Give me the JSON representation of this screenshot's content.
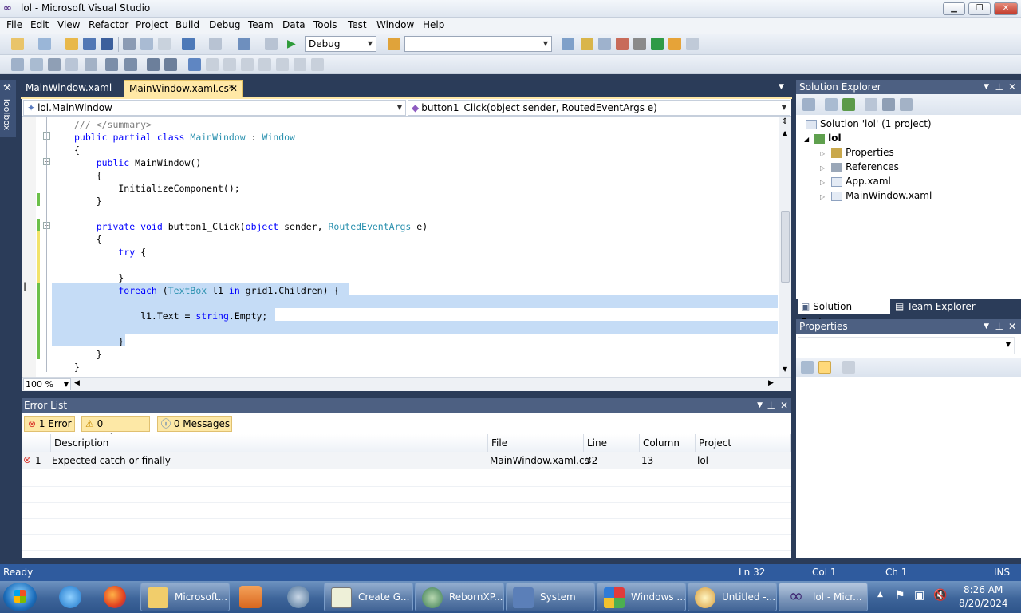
{
  "window": {
    "title": "lol - Microsoft Visual Studio",
    "minimize": "▁",
    "maximize": "❐",
    "close": "✕"
  },
  "menu": [
    "File",
    "Edit",
    "View",
    "Refactor",
    "Project",
    "Build",
    "Debug",
    "Team",
    "Data",
    "Tools",
    "Test",
    "Window",
    "Help"
  ],
  "toolbar": {
    "config": "Debug",
    "platform": ""
  },
  "toolbox_label": "Toolbox",
  "tabs": [
    {
      "label": "MainWindow.xaml",
      "active": false
    },
    {
      "label": "MainWindow.xaml.cs*",
      "active": true
    }
  ],
  "editor": {
    "class_combo": "lol.MainWindow",
    "member_combo": "button1_Click(object sender, RoutedEventArgs e)",
    "zoom": "100 %",
    "lines": [
      [
        {
          "t": "/// </summary>",
          "c": "cm"
        }
      ],
      [
        {
          "t": "public partial class ",
          "c": "kw"
        },
        {
          "t": "MainWindow",
          "c": "ty"
        },
        {
          "t": " : ",
          "c": ""
        },
        {
          "t": "Window",
          "c": "ty"
        }
      ],
      [
        {
          "t": "{",
          "c": ""
        }
      ],
      [
        {
          "t": "    public ",
          "c": "kw"
        },
        {
          "t": "MainWindow()",
          "c": ""
        }
      ],
      [
        {
          "t": "    {",
          "c": ""
        }
      ],
      [
        {
          "t": "        InitializeComponent();",
          "c": ""
        }
      ],
      [
        {
          "t": "    }",
          "c": ""
        }
      ],
      [
        {
          "t": "",
          "c": ""
        }
      ],
      [
        {
          "t": "    private void ",
          "c": "kw"
        },
        {
          "t": "button1_Click(",
          "c": ""
        },
        {
          "t": "object",
          "c": "kw"
        },
        {
          "t": " sender, ",
          "c": ""
        },
        {
          "t": "RoutedEventArgs",
          "c": "ty"
        },
        {
          "t": " e)",
          "c": ""
        }
      ],
      [
        {
          "t": "    {",
          "c": ""
        }
      ],
      [
        {
          "t": "        try",
          "c": "kw"
        },
        {
          "t": " {",
          "c": ""
        }
      ],
      [
        {
          "t": "",
          "c": ""
        }
      ],
      [
        {
          "t": "        }",
          "c": ""
        }
      ],
      [
        {
          "t": "        foreach",
          "c": "kw"
        },
        {
          "t": " (",
          "c": ""
        },
        {
          "t": "TextBox",
          "c": "ty"
        },
        {
          "t": " l1 ",
          "c": ""
        },
        {
          "t": "in",
          "c": "kw"
        },
        {
          "t": " grid1.Children) {",
          "c": ""
        }
      ],
      [
        {
          "t": "",
          "c": ""
        }
      ],
      [
        {
          "t": "            l1.Text = ",
          "c": ""
        },
        {
          "t": "string",
          "c": "kw"
        },
        {
          "t": ".Empty;",
          "c": ""
        }
      ],
      [
        {
          "t": "",
          "c": ""
        }
      ],
      [
        {
          "t": "        }",
          "c": ""
        }
      ],
      [
        {
          "t": "    }",
          "c": ""
        }
      ],
      [
        {
          "t": "}",
          "c": ""
        }
      ]
    ]
  },
  "error_list": {
    "title": "Error List",
    "filters": [
      "1 Error",
      "0 Warnings",
      "0 Messages"
    ],
    "columns": [
      "Description",
      "File",
      "Line",
      "Column",
      "Project"
    ],
    "rows": [
      {
        "num": "1",
        "description": "Expected catch or finally",
        "file": "MainWindow.xaml.cs",
        "line": "32",
        "column": "13",
        "project": "lol"
      }
    ]
  },
  "solution_explorer": {
    "title": "Solution Explorer",
    "solution": "Solution 'lol' (1 project)",
    "project": "lol",
    "items": [
      "Properties",
      "References",
      "App.xaml",
      "MainWindow.xaml"
    ],
    "tabs": [
      "Solution Explorer",
      "Team Explorer"
    ]
  },
  "properties_panel": {
    "title": "Properties"
  },
  "status": {
    "ready": "Ready",
    "ln": "Ln 32",
    "col": "Col 1",
    "ch": "Ch 1",
    "ins": "INS"
  },
  "taskbar": {
    "buttons": [
      "Microsoft...",
      "Create G...",
      "RebornXP...",
      "System",
      "Windows ...",
      "Untitled -...",
      "lol - Micr..."
    ],
    "time": "8:26 AM",
    "date": "8/20/2024"
  },
  "colors": {
    "accent": "#ffe8a6",
    "frame": "#2b3c59",
    "selection": "#c5dcf6",
    "keyword": "#0000ff",
    "type": "#2b91af",
    "error": "#d9342b"
  }
}
